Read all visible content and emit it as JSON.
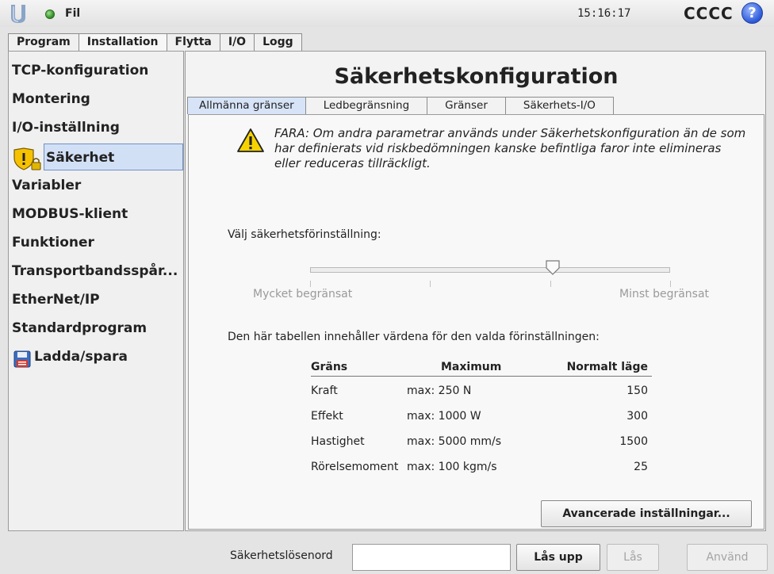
{
  "topbar": {
    "file_label": "Fil",
    "clock": "15:16:17",
    "robot_name": "CCCC",
    "help_glyph": "?"
  },
  "top_tabs": [
    "Program",
    "Installation",
    "Flytta",
    "I/O",
    "Logg"
  ],
  "active_top_tab": "Installation",
  "sidebar": {
    "items": [
      "TCP-konfiguration",
      "Montering",
      "I/O-inställning",
      "Säkerhet",
      "Variabler",
      "MODBUS-klient",
      "Funktioner",
      "Transportbandsspår...",
      "EtherNet/IP",
      "Standardprogram",
      "Ladda/spara"
    ],
    "selected": "Säkerhet",
    "icons": {
      "Säkerhet": "shield-lock-icon",
      "Ladda/spara": "floppy-disk-icon"
    }
  },
  "content": {
    "title": "Säkerhetskonfiguration",
    "subtabs": [
      "Allmänna gränser",
      "Ledbegränsning",
      "Gränser",
      "Säkerhets-I/O"
    ],
    "active_subtab": "Allmänna gränser",
    "warning": "FARA: Om andra parametrar används under Säkerhetskonfiguration än de som har definierats vid riskbedömningen kanske befintliga faror inte elimineras eller reduceras tillräckligt.",
    "preset_label": "Välj säkerhetsförinställning:",
    "slider": {
      "min_label": "Mycket begränsat",
      "max_label": "Minst begränsat",
      "steps": 4,
      "selected_step": 3
    },
    "table_caption": "Den här tabellen innehåller värdena för den valda förinställningen:",
    "table": {
      "headers": [
        "Gräns",
        "Maximum",
        "Normalt läge"
      ],
      "rows": [
        [
          "Kraft",
          "max: 250 N",
          "150"
        ],
        [
          "Effekt",
          "max: 1000 W",
          "300"
        ],
        [
          "Hastighet",
          "max: 5000 mm/s",
          "1500"
        ],
        [
          "Rörelsemoment",
          "max: 100 kgm/s",
          "25"
        ]
      ]
    },
    "advanced_button": "Avancerade inställningar..."
  },
  "bottom": {
    "password_label": "Säkerhetslösenord",
    "password_value": "",
    "unlock_button": "Lås upp",
    "lock_button": "Lås",
    "apply_button": "Använd"
  },
  "colors": {
    "selected_bg": "#d2e0f6",
    "warning_yellow": "#f6d300",
    "status_green": "#2e8a22",
    "help_blue": "#2c58d8"
  }
}
